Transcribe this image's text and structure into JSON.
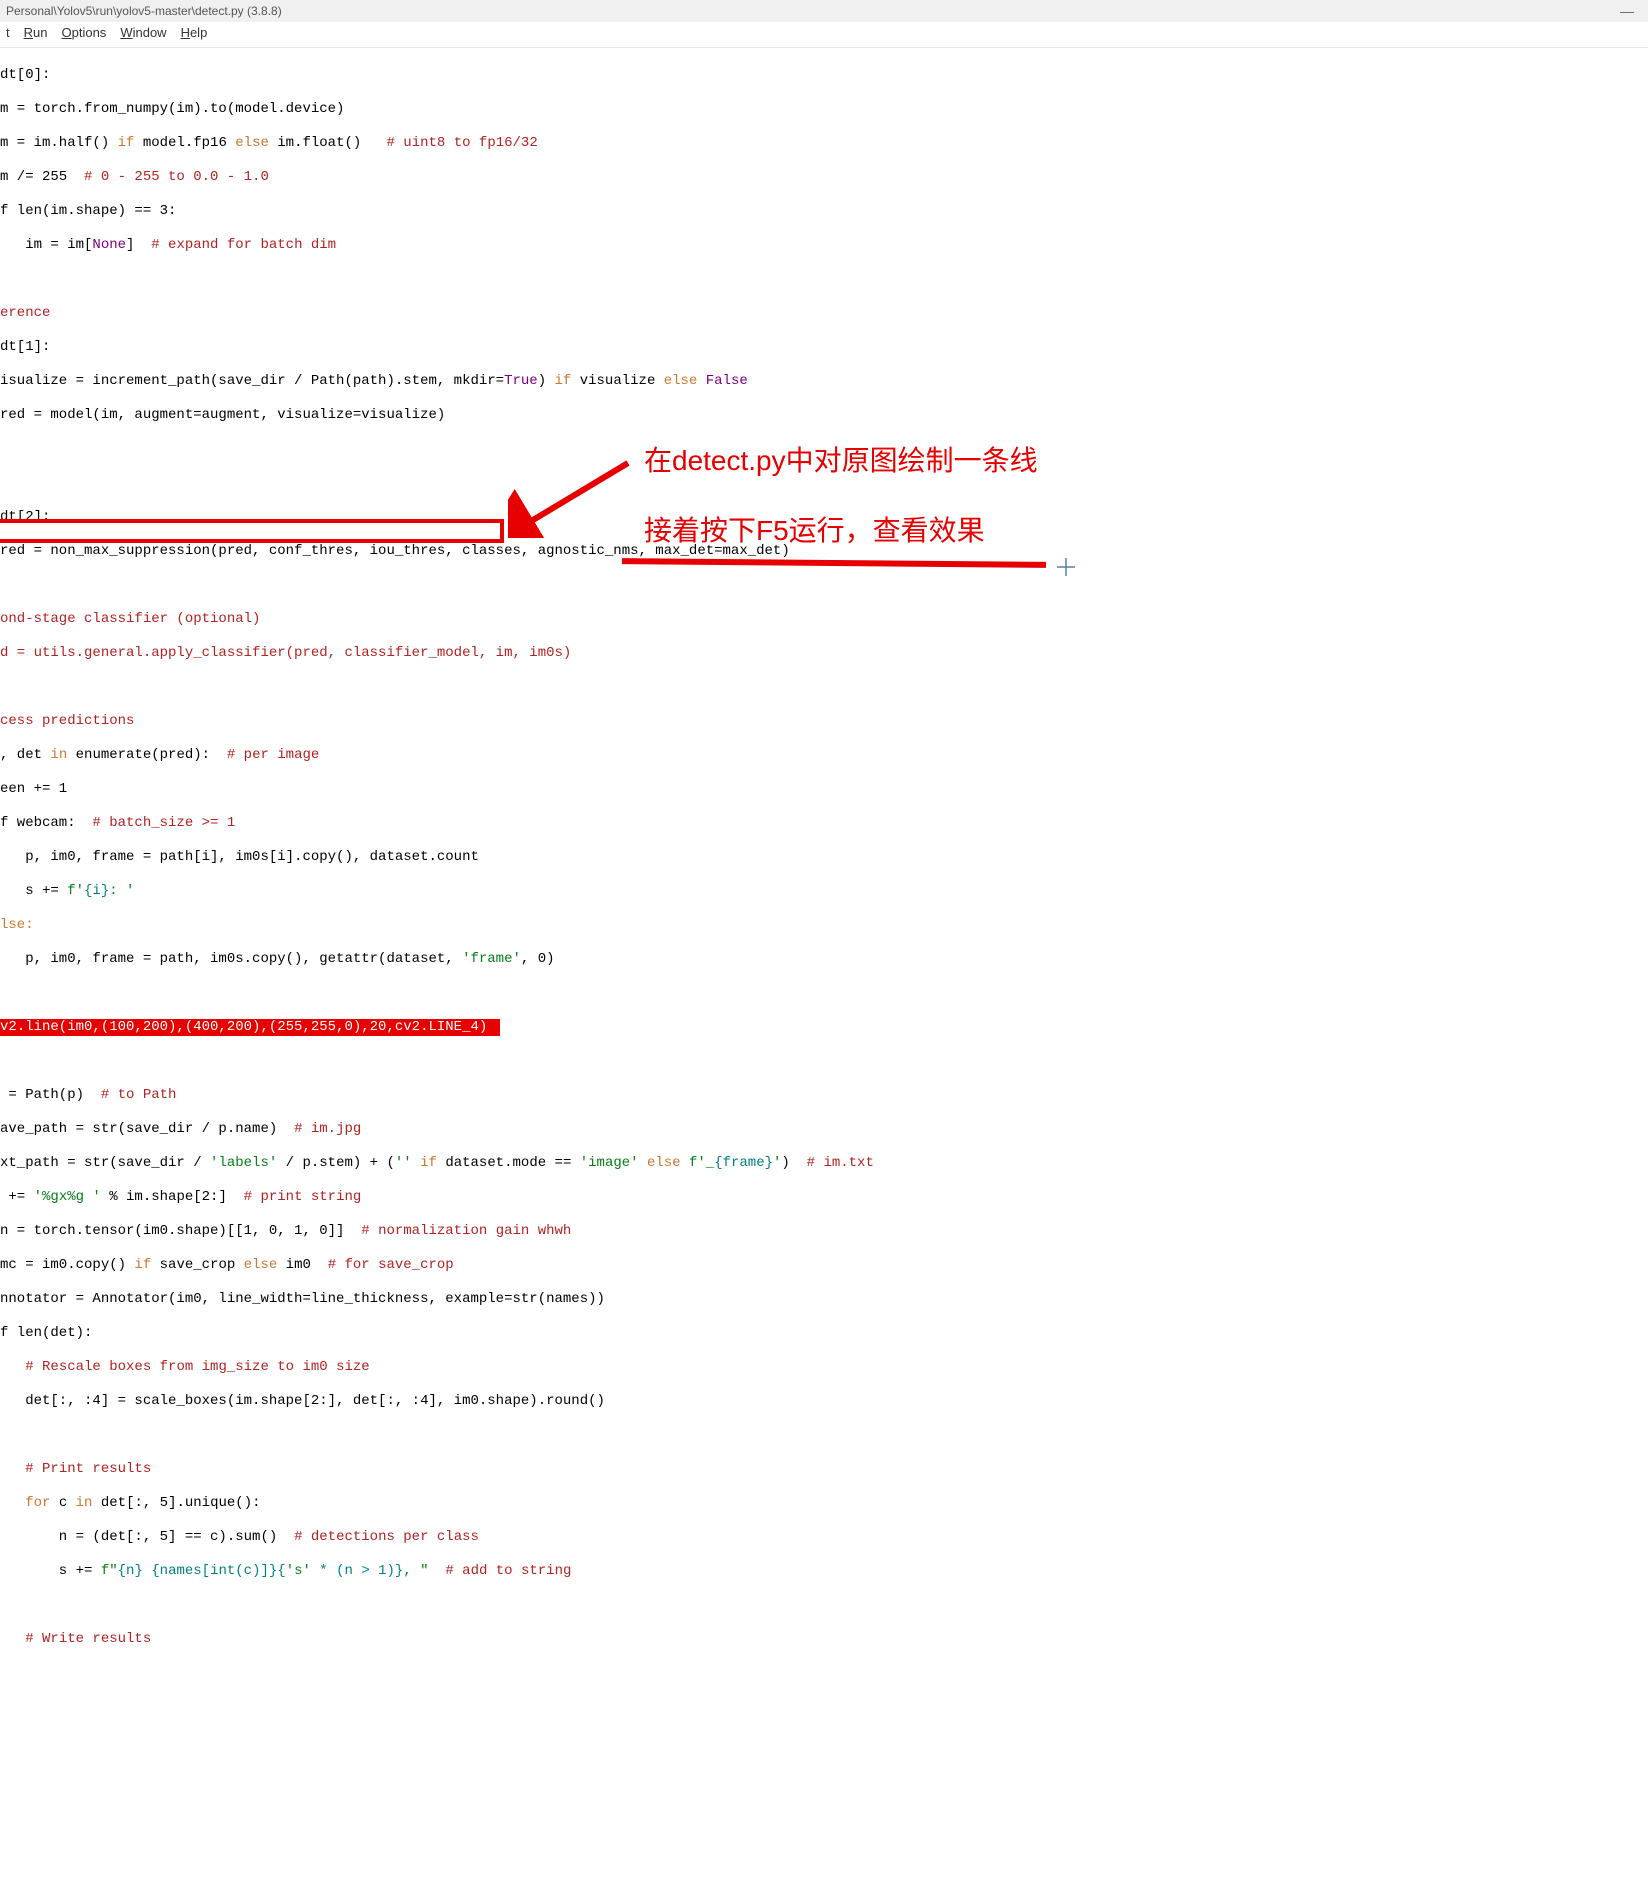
{
  "window": {
    "title": "Personal\\Yolov5\\run\\yolov5-master\\detect.py (3.8.8)"
  },
  "menu": {
    "edit": "Edit",
    "run": "Run",
    "options": "Options",
    "window": "Window",
    "help": "Help",
    "edit_short": "t",
    "run_u": "R",
    "run_rest": "un",
    "options_u": "O",
    "options_rest": "ptions",
    "window_u": "W",
    "window_rest": "indow",
    "help_u": "H",
    "help_rest": "elp"
  },
  "annotation": {
    "line1": "在detect.py中对原图绘制一条线",
    "line2": "接着按下F5运行，查看效果"
  },
  "code": {
    "l1": "dt[0]:",
    "l2a": "m = torch.from_numpy(im).to(model.device)",
    "l3a": "m = im.half() ",
    "l3b": "if",
    "l3c": " model.fp16 ",
    "l3d": "else",
    "l3e": " im.float()   ",
    "l3f": "# uint8 to fp16/32",
    "l4a": "m /= 255  ",
    "l4b": "# 0 - 255 to 0.0 - 1.0",
    "l5a": "f len(im.shape) == 3:",
    "l6a": "   im = im[",
    "l6b": "None",
    "l6c": "]  ",
    "l6d": "# expand for batch dim",
    "l7": "",
    "l8": "erence",
    "l9": "dt[1]:",
    "l10a": "isualize = increment_path(save_dir / Path(path).stem, mkdir=",
    "l10b": "True",
    "l10c": ") ",
    "l10d": "if",
    "l10e": " visualize ",
    "l10f": "else",
    "l10g": " ",
    "l10h": "False",
    "l11": "red = model(im, augment=augment, visualize=visualize)",
    "l12": "",
    "l13": "",
    "l14": "dt[2]:",
    "l15": "red = non_max_suppression(pred, conf_thres, iou_thres, classes, agnostic_nms, max_det=max_det)",
    "l16": "",
    "l17": "ond-stage classifier (optional)",
    "l18": "d = utils.general.apply_classifier(pred, classifier_model, im, im0s)",
    "l19": "",
    "l20": "cess predictions",
    "l21a": ", det ",
    "l21b": "in",
    "l21c": " enumerate(pred):  ",
    "l21d": "# per image",
    "l22": "een += 1",
    "l23a": "f webcam:  ",
    "l23b": "# batch_size >= 1",
    "l24": "   p, im0, frame = path[i], im0s[i].copy(), dataset.count",
    "l25a": "   s += ",
    "l25b": "f'",
    "l25c": "{i}",
    "l25d": ": '",
    "l26": "lse:",
    "l27a": "   p, im0, frame = path, im0s.copy(), getattr(dataset, ",
    "l27b": "'frame'",
    "l27c": ", 0)",
    "l28": "",
    "l29": "v2.line(im0,(100,200),(400,200),(255,255,0),20,cv2.LINE_4)",
    "l30": "",
    "l31a": " = Path(p)  ",
    "l31b": "# to Path",
    "l32a": "ave_path = str(save_dir / p.name)  ",
    "l32b": "# im.jpg",
    "l33a": "xt_path = str(save_dir / ",
    "l33b": "'labels'",
    "l33c": " / p.stem) + (",
    "l33d": "''",
    "l33e": " ",
    "l33f": "if",
    "l33g": " dataset.mode == ",
    "l33h": "'image'",
    "l33i": " ",
    "l33j": "else",
    "l33k": " ",
    "l33l": "f'_",
    "l33m": "{frame}",
    "l33n": "'",
    "l33o": ")  ",
    "l33p": "# im.txt",
    "l34a": " += ",
    "l34b": "'%gx%g '",
    "l34c": " % im.shape[2:]  ",
    "l34d": "# print string",
    "l35a": "n = torch.tensor(im0.shape)[[1, 0, 1, 0]]  ",
    "l35b": "# normalization gain whwh",
    "l36a": "mc = im0.copy() ",
    "l36b": "if",
    "l36c": " save_crop ",
    "l36d": "else",
    "l36e": " im0  ",
    "l36f": "# for save_crop",
    "l37": "nnotator = Annotator(im0, line_width=line_thickness, example=str(names))",
    "l38": "f len(det):",
    "l39a": "   ",
    "l39b": "# Rescale boxes from img_size to im0 size",
    "l40": "   det[:, :4] = scale_boxes(im.shape[2:], det[:, :4], im0.shape).round()",
    "l41": "",
    "l42a": "   ",
    "l42b": "# Print results",
    "l43a": "   ",
    "l43b": "for",
    "l43c": " c ",
    "l43d": "in",
    "l43e": " det[:, 5].unique():",
    "l44a": "       n = (det[:, 5] == c).sum()  ",
    "l44b": "# detections per class",
    "l45a": "       s += ",
    "l45b": "f\"",
    "l45c": "{n}",
    "l45d": " ",
    "l45e": "{names[int(c)]}{",
    "l45f": "'s'",
    "l45g": " * (n > 1)}",
    "l45h": ", \"",
    "l45i": "  ",
    "l45j": "# add to string",
    "l46": "",
    "l47a": "   ",
    "l47b": "# Write results"
  }
}
